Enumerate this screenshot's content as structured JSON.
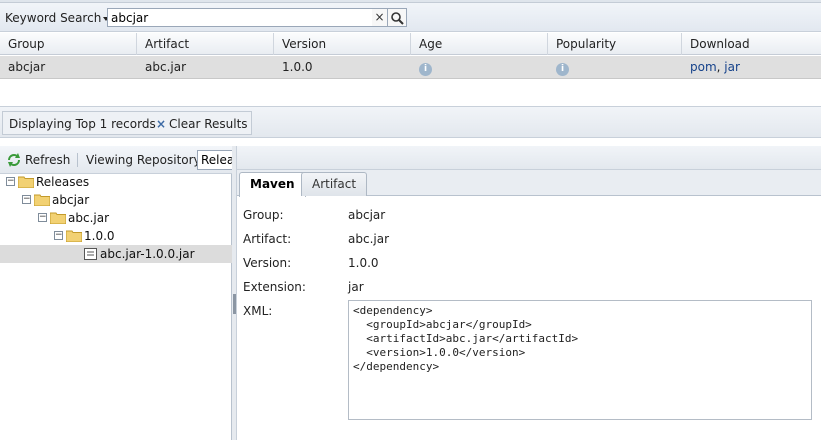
{
  "search": {
    "mode_label": "Keyword Search",
    "value": "abcjar",
    "clear_icon": "×",
    "search_icon": "magnifier-icon"
  },
  "grid": {
    "columns": [
      "Group",
      "Artifact",
      "Version",
      "Age",
      "Popularity",
      "Download"
    ],
    "rows": [
      {
        "group": "abcjar",
        "artifact": "abc.jar",
        "version": "1.0.0",
        "age_icon": "info-icon",
        "popularity_icon": "info-icon",
        "download_pom": "pom",
        "download_sep": ", ",
        "download_jar": "jar"
      }
    ]
  },
  "status": {
    "text": "Displaying Top 1 records",
    "clear_icon": "×",
    "clear_label": "Clear Results"
  },
  "repo_panel": {
    "refresh_label": "Refresh",
    "viewing_label": "Viewing Repository:",
    "selected_repo": "Releases",
    "tree": [
      {
        "label": "Releases",
        "depth": 0,
        "type": "folder",
        "toggle": "−"
      },
      {
        "label": "abcjar",
        "depth": 1,
        "type": "folder",
        "toggle": "−"
      },
      {
        "label": "abc.jar",
        "depth": 2,
        "type": "folder",
        "toggle": "−"
      },
      {
        "label": "1.0.0",
        "depth": 3,
        "type": "folder",
        "toggle": "−"
      },
      {
        "label": "abc.jar-1.0.0.jar",
        "depth": 4,
        "type": "file",
        "selected": true
      }
    ]
  },
  "detail": {
    "tabs": [
      "Maven",
      "Artifact"
    ],
    "active_tab": "Maven",
    "fields": {
      "group_label": "Group:",
      "group_value": "abcjar",
      "artifact_label": "Artifact:",
      "artifact_value": "abc.jar",
      "version_label": "Version:",
      "version_value": "1.0.0",
      "extension_label": "Extension:",
      "extension_value": "jar",
      "xml_label": "XML:"
    },
    "xml": "<dependency>\n  <groupId>abcjar</groupId>\n  <artifactId>abc.jar</artifactId>\n  <version>1.0.0</version>\n</dependency>"
  },
  "colors": {
    "selection": "#dfdfdf",
    "link": "#15428b",
    "toolbar": "#e3e8ee"
  }
}
